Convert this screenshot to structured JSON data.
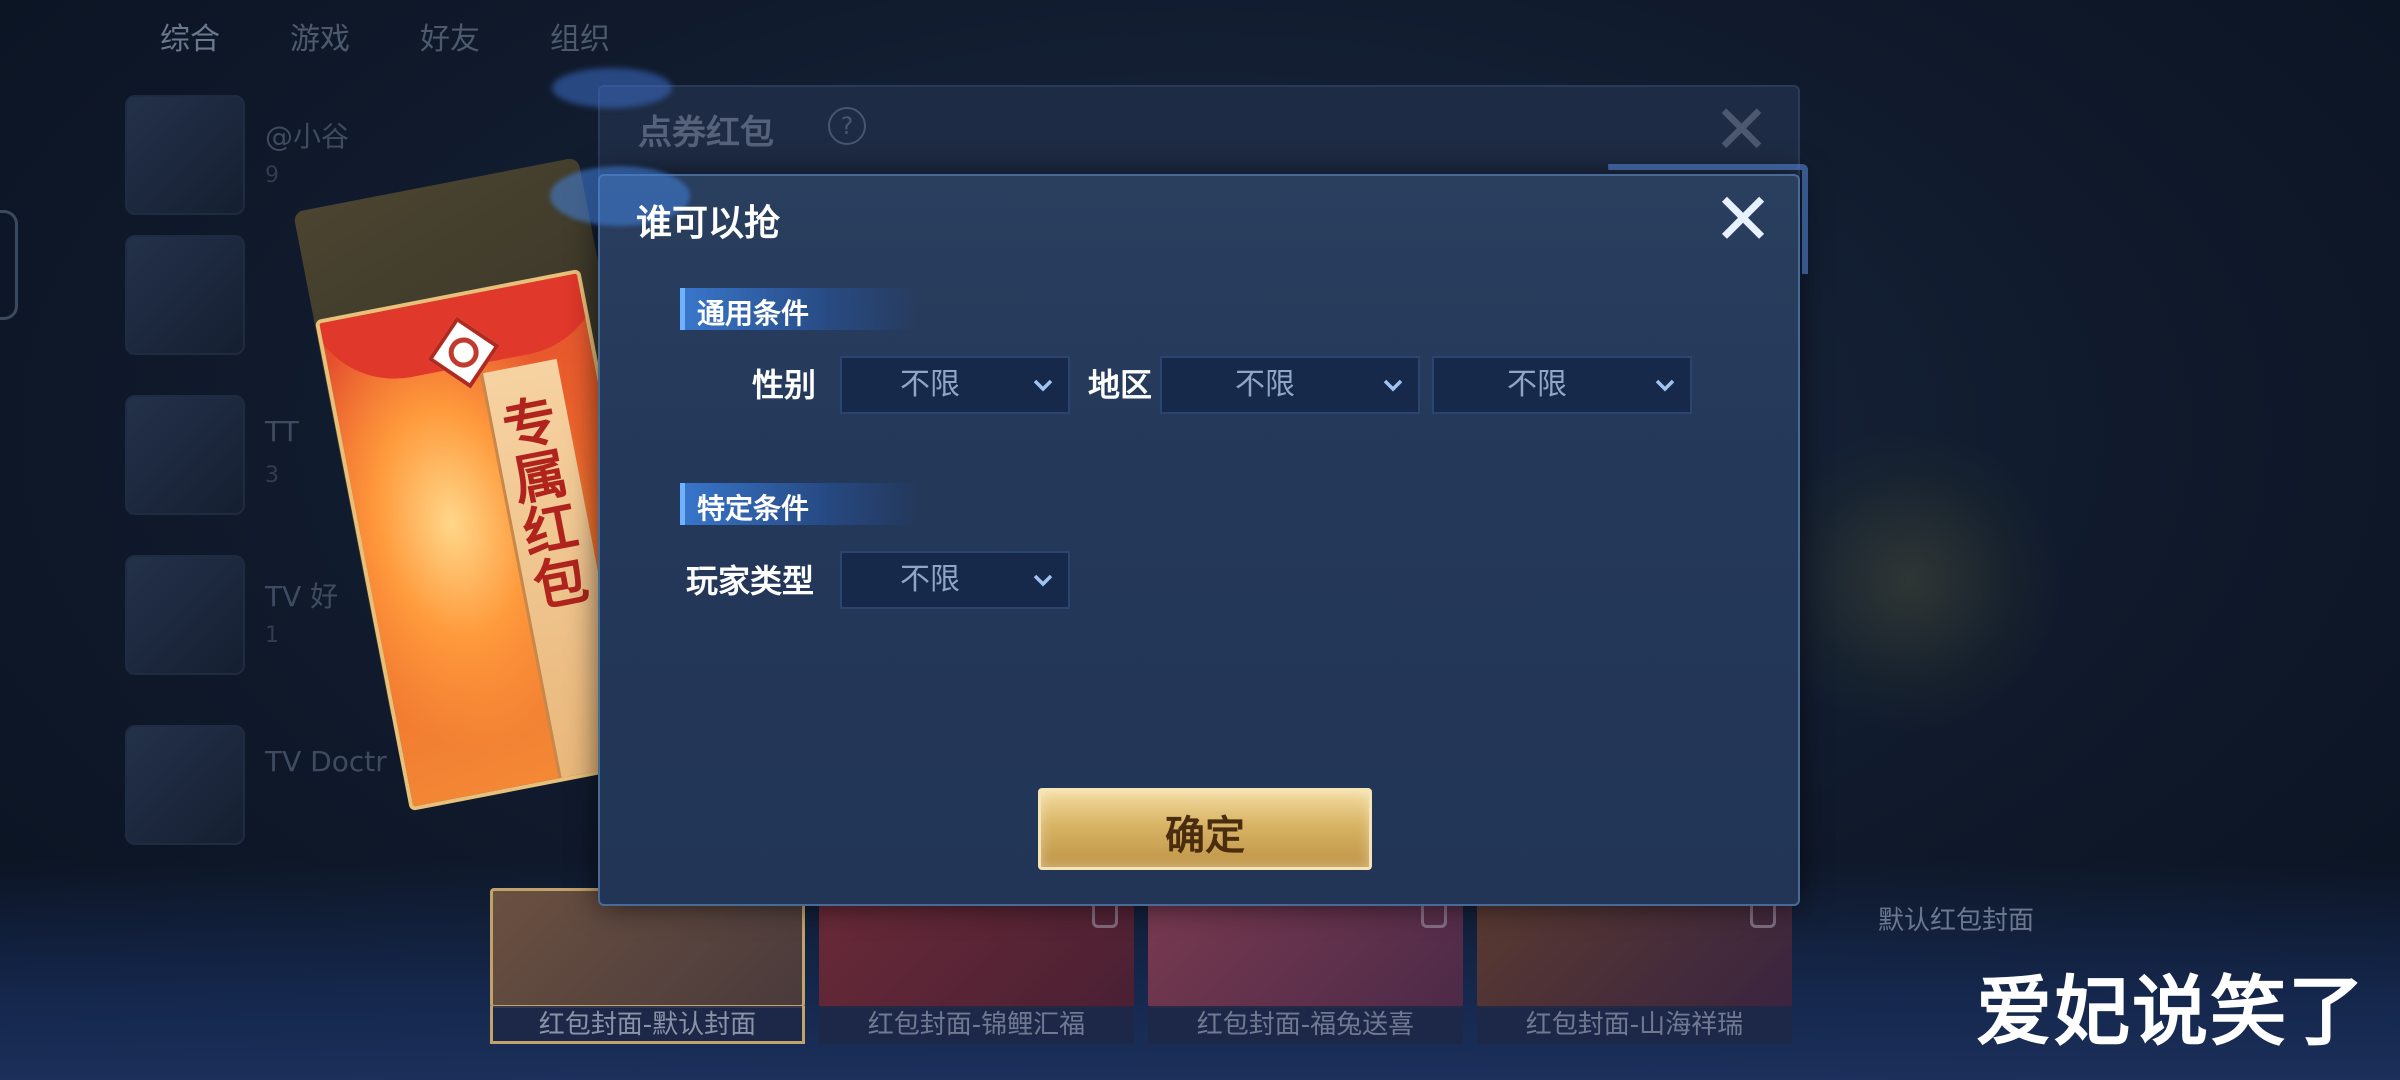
{
  "background": {
    "tabs": [
      "综合",
      "游戏",
      "好友",
      "组织"
    ],
    "list_rows": [
      {
        "name": "@小谷",
        "sub": "9"
      },
      {
        "name": "",
        "sub": ""
      },
      {
        "name": "TT",
        "sub": "3"
      },
      {
        "name": "TV 好",
        "sub": "1"
      },
      {
        "name": "TV Doctr",
        "sub": ""
      }
    ],
    "parent_dialog": {
      "title": "点券红包",
      "help": "?",
      "close": "✕"
    },
    "envelope_text": "专属红包",
    "covers": [
      {
        "label": "红包封面-默认封面",
        "selected": true,
        "locked": false
      },
      {
        "label": "红包封面-锦鲤汇福",
        "selected": false,
        "locked": true
      },
      {
        "label": "红包封面-福兔送喜",
        "selected": false,
        "locked": true
      },
      {
        "label": "红包封面-山海祥瑞",
        "selected": false,
        "locked": true
      }
    ],
    "default_cover_label": "默认红包封面"
  },
  "dialog": {
    "title": "谁可以抢",
    "close": "✕",
    "sections": {
      "general": {
        "title": "通用条件",
        "gender_label": "性别",
        "gender_value": "不限",
        "region_label": "地区",
        "region_value_1": "不限",
        "region_value_2": "不限"
      },
      "special": {
        "title": "特定条件",
        "player_type_label": "玩家类型",
        "player_type_value": "不限"
      }
    },
    "confirm_label": "确定"
  },
  "watermark": "爱妃说笑了",
  "colors": {
    "dialog_bg": "#24385a",
    "section_accent": "#3a7cd6",
    "confirm_gold": "#d8b465",
    "select_bg": "#17294a"
  }
}
